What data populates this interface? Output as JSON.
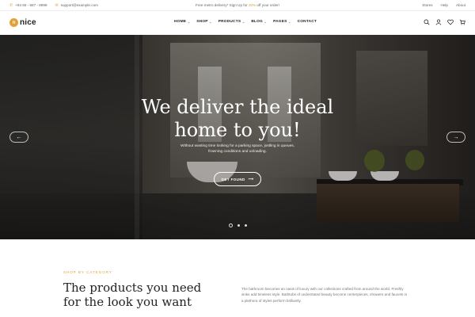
{
  "topbar": {
    "phone": "+84 66 - 567 - 8999",
    "email": "support@example.com",
    "promo_prefix": "Free metro delivery* Sign Up for ",
    "promo_highlight": "20%",
    "promo_suffix": " off your order!",
    "links": [
      "Stores",
      "Help",
      "About"
    ]
  },
  "header": {
    "logo_mark": "n",
    "logo_text": "nice",
    "nav": [
      {
        "label": "HOME",
        "caret": true
      },
      {
        "label": "SHOP",
        "caret": true
      },
      {
        "label": "PRODUCTS",
        "caret": true
      },
      {
        "label": "BLOG",
        "caret": true
      },
      {
        "label": "PAGES",
        "caret": true
      },
      {
        "label": "CONTACT",
        "caret": false
      }
    ],
    "icons": [
      "search-icon",
      "user-icon",
      "heart-icon",
      "cart-icon"
    ]
  },
  "hero": {
    "title_line1": "We deliver the ideal",
    "title_line2": "home to you!",
    "subtitle": "Without wasting time looking for a parking space, jostling in queues, frowning conditions and unloading.",
    "button_label": "GET FOUND",
    "slides": 3,
    "active_slide": 1
  },
  "category": {
    "eyebrow": "SHOP BY CATEGORY",
    "title_line1": "The products you need",
    "title_line2": "for the look you want",
    "description": "The bathroom becomes an oasis of luxury with our collections crafted from around the world. Freshly sinks add timeless style. Bathtubs of understated beauty become centerpieces, showers and faucets in a plethora of styles perform brilliantly."
  },
  "colors": {
    "accent": "#e2a13c",
    "text": "#222222",
    "muted": "#777777"
  }
}
